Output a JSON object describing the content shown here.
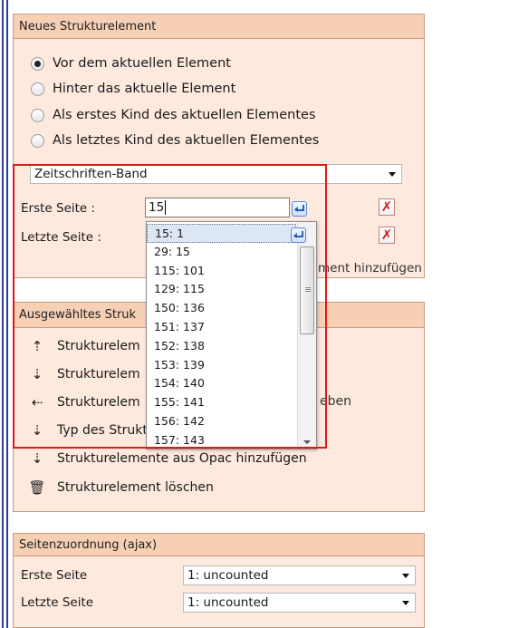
{
  "panel_new": {
    "title": "Neues Strukturelement",
    "positions": [
      {
        "label": "Vor dem aktuellen Element",
        "checked": true
      },
      {
        "label": "Hinter das aktuelle Element",
        "checked": false
      },
      {
        "label": "Als erstes Kind des aktuellen Elementes",
        "checked": false
      },
      {
        "label": "Als letztes Kind des aktuellen Elementes",
        "checked": false
      }
    ],
    "type_select": "Zeitschriften-Band",
    "first_page_label": "Erste Seite :",
    "first_page_value": "15",
    "last_page_label": "Letzte Seite :",
    "add_link_tail": "ment hinzufügen"
  },
  "page_dropdown": {
    "options": [
      "15: 1",
      "29: 15",
      "115: 101",
      "129: 115",
      "150: 136",
      "151: 137",
      "152: 138",
      "153: 139",
      "154: 140",
      "155: 141",
      "156: 142",
      "157: 143"
    ],
    "selected_index": 0
  },
  "panel_selected": {
    "title": "Ausgewähltes Struk",
    "actions": [
      {
        "label": "Strukturelem",
        "icon": "move-up-icon",
        "glyph": "⇡"
      },
      {
        "label": "Strukturelem",
        "icon": "move-down-icon",
        "glyph": "⇣"
      },
      {
        "label": "Strukturelem",
        "suffix": "eben",
        "icon": "move-left-icon",
        "glyph": "⇠"
      },
      {
        "label": "Typ des Strukt",
        "icon": "change-type-icon",
        "glyph": "⇣"
      },
      {
        "label": "Strukturelemente aus Opac hinzufügen",
        "icon": "opac-import-icon",
        "glyph": "⇣"
      },
      {
        "label": "Strukturelement löschen",
        "icon": "trash-icon",
        "glyph": "🗑"
      }
    ]
  },
  "panel_pages": {
    "title": "Seitenzuordnung (ajax)",
    "first_page_label": "Erste Seite",
    "first_page_value": "1: uncounted",
    "last_page_label": "Letzte Seite",
    "last_page_value": "1: uncounted"
  },
  "colors": {
    "panel_bg": "#fde9de",
    "panel_header": "#f6cfb5",
    "highlight": "#e01818",
    "clear_icon": "#d21d1d"
  }
}
